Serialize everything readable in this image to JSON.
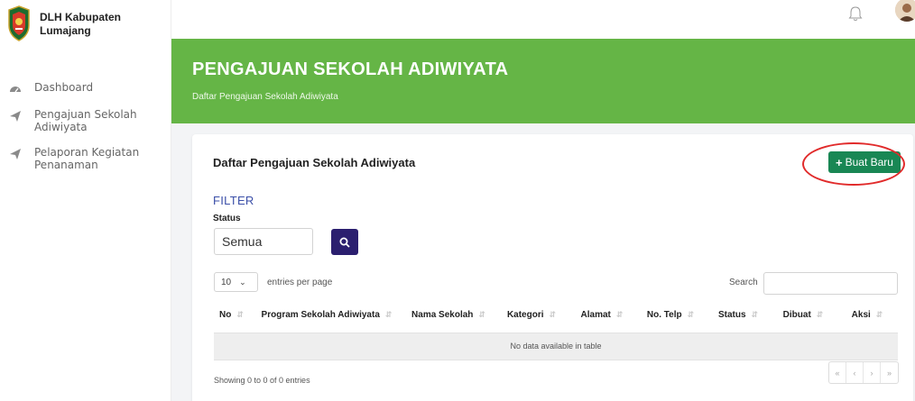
{
  "brand": {
    "name": "DLH Kabupaten Lumajang",
    "logo": "emblem-logo"
  },
  "sidebar": {
    "items": [
      {
        "label": "Dashboard",
        "icon": "dashboard-icon"
      },
      {
        "label": "Pengajuan Sekolah Adiwiyata",
        "icon": "send-icon"
      },
      {
        "label": "Pelaporan Kegiatan Penanaman",
        "icon": "send-icon"
      }
    ]
  },
  "topbar": {
    "notification_icon": "bell-icon",
    "avatar": "user-avatar"
  },
  "hero": {
    "title": "PENGAJUAN SEKOLAH ADIWIYATA",
    "subtitle": "Daftar Pengajuan Sekolah Adiwiyata",
    "color": "#65b546"
  },
  "card": {
    "title": "Daftar Pengajuan Sekolah Adiwiyata",
    "new_button": "Buat Baru",
    "filter_title": "FILTER",
    "status_label": "Status",
    "status_value": "Semua",
    "entries_value": "10",
    "entries_text": "entries per page",
    "search_label": "Search",
    "columns": [
      "No",
      "Program Sekolah Adiwiyata",
      "Nama Sekolah",
      "Kategori",
      "Alamat",
      "No. Telp",
      "Status",
      "Dibuat",
      "Aksi"
    ],
    "empty_text": "No data available in table",
    "info": "Showing 0 to 0 of 0 entries",
    "pager": [
      "«",
      "‹",
      "›",
      "»"
    ]
  },
  "colors": {
    "accent": "#198754",
    "search_button": "#2b1f6f",
    "filter": "#3b4fa8",
    "highlight": "#e12b2b"
  }
}
